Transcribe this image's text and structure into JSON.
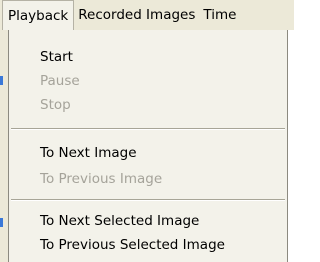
{
  "menubar": {
    "items": [
      {
        "label": "Playback"
      },
      {
        "label": "Recorded Images"
      },
      {
        "label": "Time"
      }
    ]
  },
  "playback_menu": {
    "items": [
      {
        "label": "Start",
        "enabled": true
      },
      {
        "label": "Pause",
        "enabled": false
      },
      {
        "label": "Stop",
        "enabled": false
      },
      {
        "label": "To Next Image",
        "enabled": true
      },
      {
        "label": "To Previous Image",
        "enabled": false
      },
      {
        "label": "To Next Selected Image",
        "enabled": true
      },
      {
        "label": "To Previous Selected Image",
        "enabled": true
      }
    ]
  }
}
